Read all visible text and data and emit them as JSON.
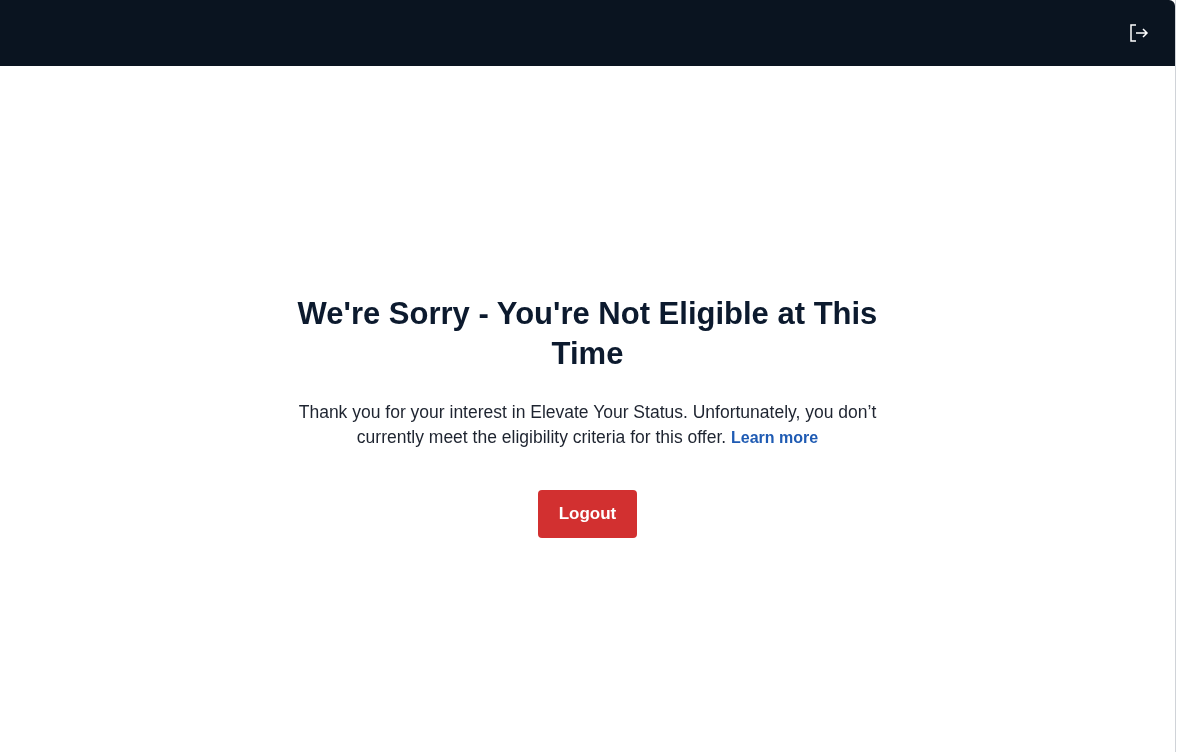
{
  "message": {
    "title": "We're Sorry - You're Not Eligible at This Time",
    "body": "Thank you for your interest in Elevate Your Status. Unfortunately, you don’t currently meet the eligibility criteria for this offer.",
    "link": "Learn more"
  },
  "buttons": [
    {
      "label": "Logout",
      "kind": "primary"
    }
  ]
}
